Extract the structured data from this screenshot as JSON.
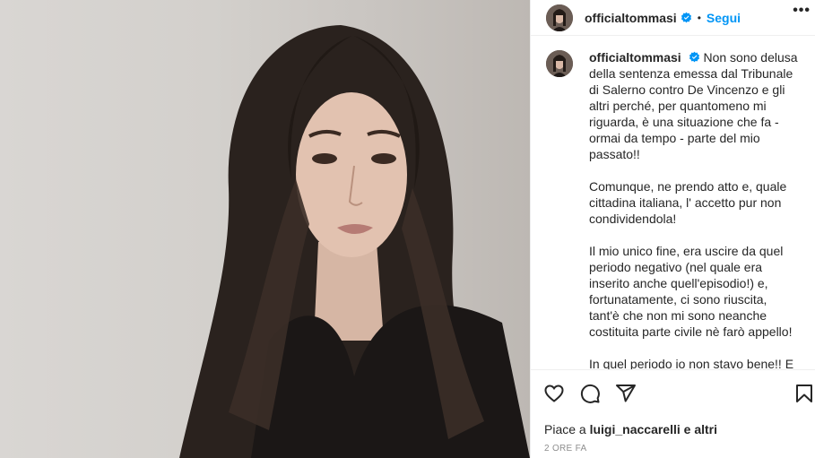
{
  "post": {
    "username": "officialtommasi",
    "separator": "•",
    "follow_label": "Segui",
    "more_label": "•••"
  },
  "caption": {
    "username": "officialtommasi",
    "paragraphs": [
      "Non sono delusa della sentenza emessa dal Tribunale di Salerno contro De Vincenzo e gli altri perché, per quantomeno mi riguarda, è una situazione che fa - ormai da tempo - parte del mio passato!!",
      "Comunque, ne prendo atto e, quale cittadina italiana, l' accetto pur non condividendola!",
      "Il mio unico fine, era uscire da quel periodo negativo (nel quale era inserito anche quell'episodio!) e, fortunatamente, ci sono riuscita, tant'è che non mi sono neanche costituita parte civile nè farò appello!",
      "In quel periodo io non stavo bene!! E questo è un dato di fatto!!!"
    ]
  },
  "likes": {
    "prefix": "Piace a",
    "user": "luigi_naccarelli",
    "suffix": "e altri"
  },
  "timestamp": "2 ORE FA",
  "icons": {
    "like": "heart-icon",
    "comment": "comment-icon",
    "share": "share-icon",
    "save": "bookmark-icon",
    "verified": "verified-badge-icon"
  },
  "colors": {
    "accent": "#0095f6",
    "text": "#262626",
    "muted": "#8e8e8e"
  }
}
